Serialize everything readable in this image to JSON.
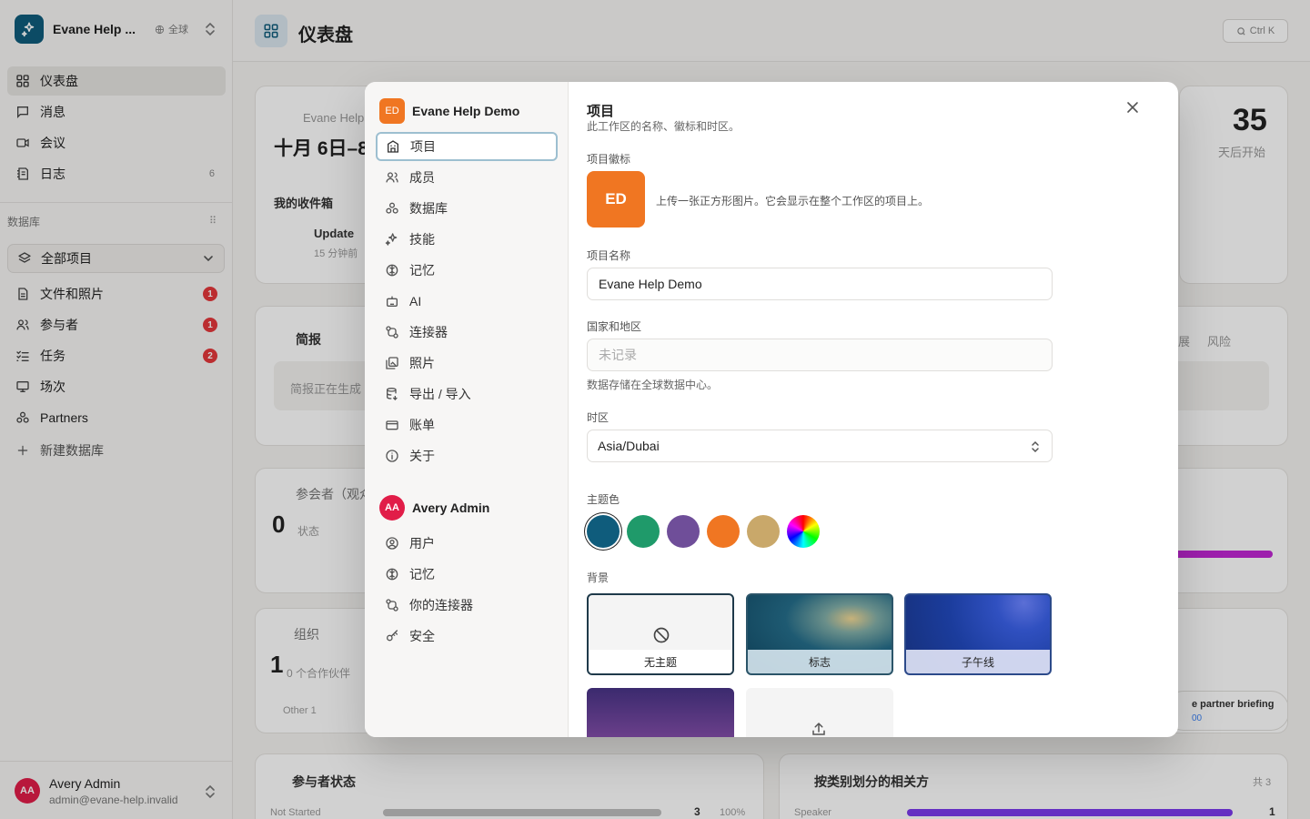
{
  "workspace": {
    "name": "Evane Help Demo",
    "name_short": "Evane Help ...",
    "region": "全球"
  },
  "sidebar": {
    "nav": [
      {
        "label": "仪表盘",
        "icon": "grid-icon"
      },
      {
        "label": "消息",
        "icon": "chat-icon"
      },
      {
        "label": "会议",
        "icon": "video-icon"
      },
      {
        "label": "日志",
        "icon": "log-icon",
        "count": "6"
      }
    ],
    "db_section_label": "数据库",
    "project_select": "全部项目",
    "db_items": [
      {
        "label": "文件和照片",
        "icon": "file-icon",
        "badge": "1"
      },
      {
        "label": "参与者",
        "icon": "users-icon",
        "badge": "1"
      },
      {
        "label": "任务",
        "icon": "tasks-icon",
        "badge": "2"
      },
      {
        "label": "场次",
        "icon": "session-icon"
      },
      {
        "label": "Partners",
        "icon": "partners-icon"
      }
    ],
    "new_db_label": "新建数据库"
  },
  "user": {
    "initials": "AA",
    "name": "Avery Admin",
    "email": "admin@evane-help.invalid"
  },
  "main": {
    "title": "仪表盘",
    "search_shortcut": "Ctrl K",
    "cards": {
      "event_org": "Evane Help",
      "date_range": "十月 6日–8",
      "countdown_value": "35",
      "countdown_label": "天后开始",
      "inbox_title": "我的收件箱",
      "inbox_item": "Update",
      "inbox_item_time": "15 分钟前",
      "brief_title": "简报",
      "brief_body": "简报正在生成",
      "brief_tab": "风险",
      "brief_tab_partial": "展",
      "attendee_title": "参会者（观众",
      "attendee_value": "0",
      "attendee_unit": "状态",
      "org_title": "组织",
      "org_value": "1",
      "org_unit": "0 个合作伙伴",
      "org_legend": "Other 1",
      "partner_briefing": "e partner briefing",
      "partner_briefing_sub": "00",
      "status_title": "参与者状态",
      "status_row_label": "Not Started",
      "status_row_value": "3",
      "status_row_pct": "100%",
      "rel_title": "按类别划分的相关方",
      "rel_total": "共 3",
      "rel_row_label": "Speaker",
      "rel_row_value": "1"
    }
  },
  "modal": {
    "project_group": {
      "initials": "ED",
      "name": "Evane Help Demo"
    },
    "project_nav": [
      {
        "label": "项目",
        "icon": "building-icon",
        "active": true
      },
      {
        "label": "成员",
        "icon": "members-icon"
      },
      {
        "label": "数据库",
        "icon": "database-icon"
      },
      {
        "label": "技能",
        "icon": "sparkle-icon"
      },
      {
        "label": "记忆",
        "icon": "brain-icon"
      },
      {
        "label": "AI",
        "icon": "robot-icon"
      },
      {
        "label": "连接器",
        "icon": "connector-icon"
      },
      {
        "label": "照片",
        "icon": "photos-icon"
      },
      {
        "label": "导出 / 导入",
        "icon": "export-icon"
      },
      {
        "label": "账单",
        "icon": "billing-icon"
      },
      {
        "label": "关于",
        "icon": "info-icon"
      }
    ],
    "user_group": {
      "initials": "AA",
      "name": "Avery Admin"
    },
    "user_nav": [
      {
        "label": "用户",
        "icon": "user-circle-icon"
      },
      {
        "label": "记忆",
        "icon": "brain-icon"
      },
      {
        "label": "你的连接器",
        "icon": "connector-icon"
      },
      {
        "label": "安全",
        "icon": "key-icon"
      }
    ],
    "content": {
      "title": "项目",
      "description": "此工作区的名称、徽标和时区。",
      "logo_label": "项目徽标",
      "logo_initials": "ED",
      "logo_hint": "上传一张正方形图片。它会显示在整个工作区的项目上。",
      "name_label": "项目名称",
      "name_value": "Evane Help Demo",
      "country_label": "国家和地区",
      "country_placeholder": "未记录",
      "storage_hint": "数据存储在全球数据中心。",
      "timezone_label": "时区",
      "timezone_value": "Asia/Dubai",
      "theme_label": "主题色",
      "theme_colors": [
        "#0f5c7c",
        "#1f9a6a",
        "#6f4e99",
        "#f07622",
        "#c9a86a"
      ],
      "theme_selected": "#0f5c7c",
      "background_label": "背景",
      "backgrounds": [
        {
          "label": "无主题",
          "icon": "ban-icon",
          "selected": true
        },
        {
          "label": "标志"
        },
        {
          "label": "子午线"
        }
      ]
    }
  }
}
